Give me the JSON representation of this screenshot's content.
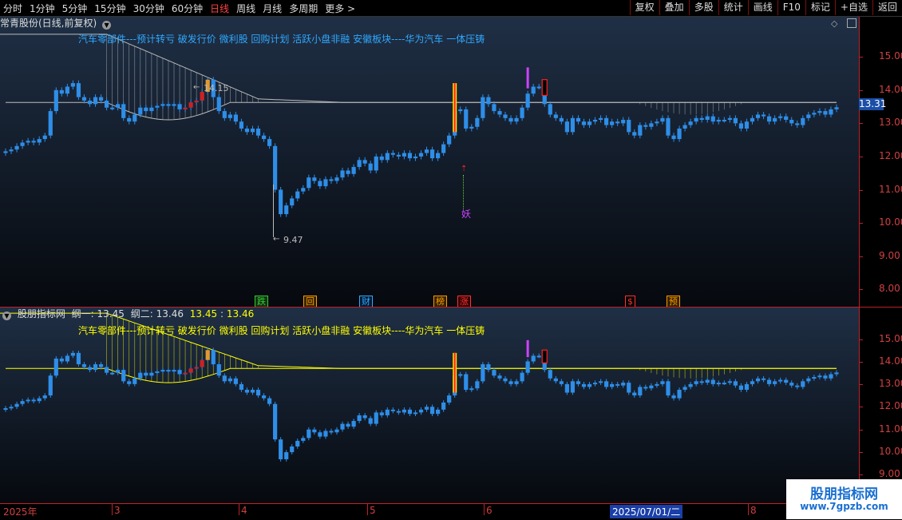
{
  "toolbar": {
    "periods": [
      "分时",
      "1分钟",
      "5分钟",
      "15分钟",
      "30分钟",
      "60分钟",
      "日线",
      "周线",
      "月线",
      "多周期",
      "更多 >"
    ],
    "active_period": "日线",
    "right_buttons": [
      "复权",
      "叠加",
      "多股",
      "统计",
      "画线",
      "F10",
      "标记",
      "+自选",
      "返回"
    ]
  },
  "main_panel": {
    "title": "常青股份(日线,前复权)",
    "concepts": "汽车零部件---预计转亏 破发行价 微利股 回购计划 活跃小盘非融 安徽板块----华为汽车 一体压铸",
    "high_label": "14.15",
    "low_label": "9.47",
    "last_price": "13.31",
    "yao_label": "妖",
    "y_ticks": [
      "15.00",
      "14.00",
      "13.00",
      "12.00",
      "11.00",
      "10.00",
      "9.00",
      "8.00"
    ],
    "badges": [
      {
        "text": "跌",
        "color": "#33cc33",
        "bg": "#113311"
      },
      {
        "text": "回",
        "color": "#ff9900",
        "bg": "#332200"
      },
      {
        "text": "财",
        "color": "#33aaff",
        "bg": "#001a33"
      },
      {
        "text": "榜",
        "color": "#ff9900",
        "bg": "#332200"
      },
      {
        "text": "涨",
        "color": "#ff3333",
        "bg": "#330000"
      },
      {
        "text": "$",
        "color": "#ff3333",
        "bg": "#000000"
      },
      {
        "text": "预",
        "color": "#ff9900",
        "bg": "#332200"
      }
    ]
  },
  "sub_panel": {
    "name": "股朋指标网",
    "line1_label": "纲一:",
    "line1_value": "13.45",
    "line2_label": "纲二:",
    "line2_value": "13.46",
    "extra_values": [
      "13.45",
      "13.46"
    ],
    "concepts": "汽车零部件---预计转亏 破发行价 微利股 回购计划 活跃小盘非融 安徽板块----华为汽车 一体压铸",
    "y_ticks": [
      "15.00",
      "14.00",
      "13.00",
      "12.00",
      "11.00",
      "10.00",
      "9.00"
    ]
  },
  "x_axis": {
    "labels": [
      "2025年",
      "3",
      "4",
      "5",
      "6",
      "2025/07/01/二",
      "8"
    ]
  },
  "watermark": {
    "title": "股朋指标网",
    "url": "www.7gpzb.com"
  },
  "colors": {
    "up_candle": "#2e8ee8",
    "bg_top": "#1f2f45",
    "bg_bottom": "#06090e",
    "axis": "#c0202a",
    "ribbon": "#ffff00",
    "ribbon_main": "#bbbbbb"
  },
  "chart_data": {
    "type": "candlestick",
    "ylim_main": [
      7.6,
      15.9
    ],
    "ylim_sub": [
      8.7,
      15.6
    ],
    "series": [
      {
        "name": "纲一",
        "values": [
          13.45
        ]
      },
      {
        "name": "纲二",
        "values": [
          13.46
        ]
      }
    ],
    "closes": [
      12.05,
      12.1,
      12.2,
      12.3,
      12.35,
      12.3,
      12.4,
      12.5,
      13.2,
      13.8,
      13.7,
      13.9,
      14.0,
      13.6,
      13.5,
      13.4,
      13.6,
      13.5,
      13.3,
      13.3,
      13.4,
      13.0,
      12.9,
      13.1,
      13.3,
      13.2,
      13.3,
      13.35,
      13.4,
      13.35,
      13.4,
      13.25,
      13.3,
      13.45,
      13.5,
      13.75,
      14.1,
      13.6,
      13.2,
      13.0,
      13.1,
      12.9,
      12.7,
      12.6,
      12.7,
      12.5,
      12.4,
      12.2,
      10.95,
      10.25,
      10.5,
      10.7,
      10.9,
      11.0,
      11.3,
      11.2,
      11.05,
      11.25,
      11.2,
      11.3,
      11.5,
      11.4,
      11.6,
      11.8,
      11.7,
      11.5,
      11.9,
      11.8,
      12.0,
      11.95,
      11.9,
      12.0,
      11.85,
      11.9,
      12.0,
      12.1,
      11.85,
      12.0,
      12.25,
      12.5,
      13.2,
      13.25,
      12.7,
      12.75,
      13.0,
      13.6,
      13.4,
      13.2,
      13.1,
      13.0,
      12.9,
      13.0,
      13.3,
      13.7,
      13.9,
      13.9,
      13.4,
      13.1,
      13.0,
      12.9,
      12.6,
      13.0,
      12.9,
      12.8,
      12.9,
      12.95,
      13.0,
      12.8,
      12.9,
      12.85,
      12.95,
      12.6,
      12.5,
      12.8,
      12.75,
      12.85,
      12.9,
      13.0,
      12.5,
      12.4,
      12.7,
      12.8,
      12.9,
      13.0,
      12.95,
      13.05,
      12.9,
      12.95,
      12.95,
      13.0,
      12.85,
      12.7,
      12.9,
      13.0,
      13.1,
      13.05,
      12.9,
      13.0,
      13.05,
      12.95,
      12.85,
      12.8,
      13.0,
      13.1,
      13.15,
      13.2,
      13.1,
      13.25,
      13.31
    ]
  }
}
